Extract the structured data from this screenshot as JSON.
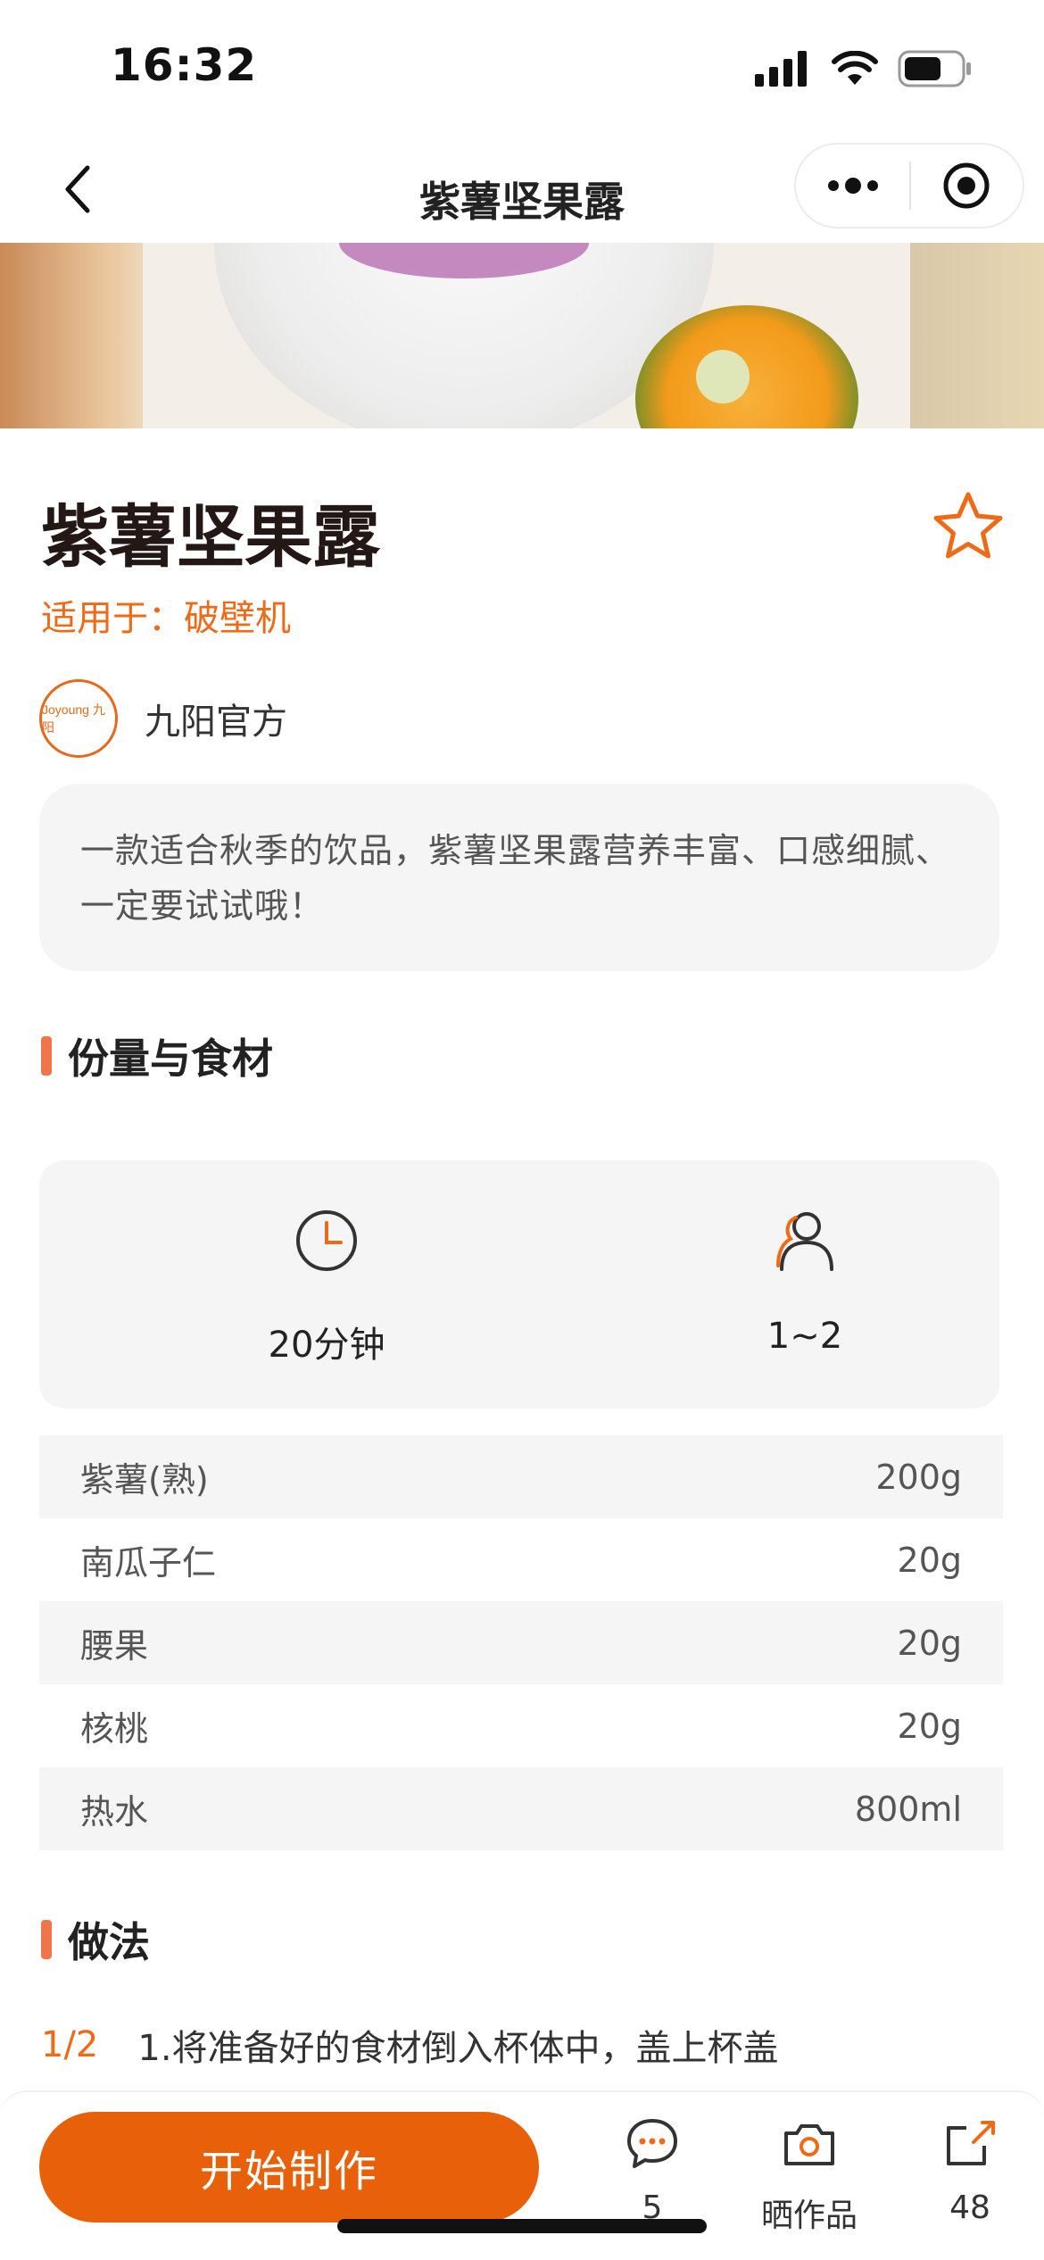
{
  "status_bar": {
    "time": "16:32"
  },
  "nav": {
    "title": "紫薯坚果露"
  },
  "recipe": {
    "title": "紫薯坚果露",
    "applicable_label": "适用于：",
    "applicable_value": "破壁机",
    "author": {
      "name": "九阳官方",
      "avatar_text": "Joyoung 九阳"
    },
    "description": "一款适合秋季的饮品，紫薯坚果露营养丰富、口感细腻、一定要试试哦！"
  },
  "sections": {
    "ingredients_title": "份量与食材",
    "method_title": "做法"
  },
  "meta": {
    "time": "20分钟",
    "servings": "1~2"
  },
  "ingredients": [
    {
      "name": "紫薯(熟)",
      "amount": "200g"
    },
    {
      "name": "南瓜子仁",
      "amount": "20g"
    },
    {
      "name": "腰果",
      "amount": "20g"
    },
    {
      "name": "核桃",
      "amount": "20g"
    },
    {
      "name": "热水",
      "amount": "800ml"
    }
  ],
  "step": {
    "index": "1/2",
    "text": "1.将准备好的食材倒入杯体中，盖上杯盖"
  },
  "bottom_bar": {
    "start_label": "开始制作",
    "comments_count": "5",
    "share_work_label": "晒作品",
    "share_count": "48"
  },
  "colors": {
    "accent": "#e8600a",
    "section_bar": "#f1754a",
    "card_bg": "#f5f5f5"
  },
  "icons": [
    "back-arrow-icon",
    "more-dots-icon",
    "mini-program-close-icon",
    "star-icon",
    "clock-icon",
    "person-icon",
    "comment-icon",
    "camera-icon",
    "share-icon",
    "signal-icon",
    "wifi-icon",
    "battery-icon"
  ]
}
